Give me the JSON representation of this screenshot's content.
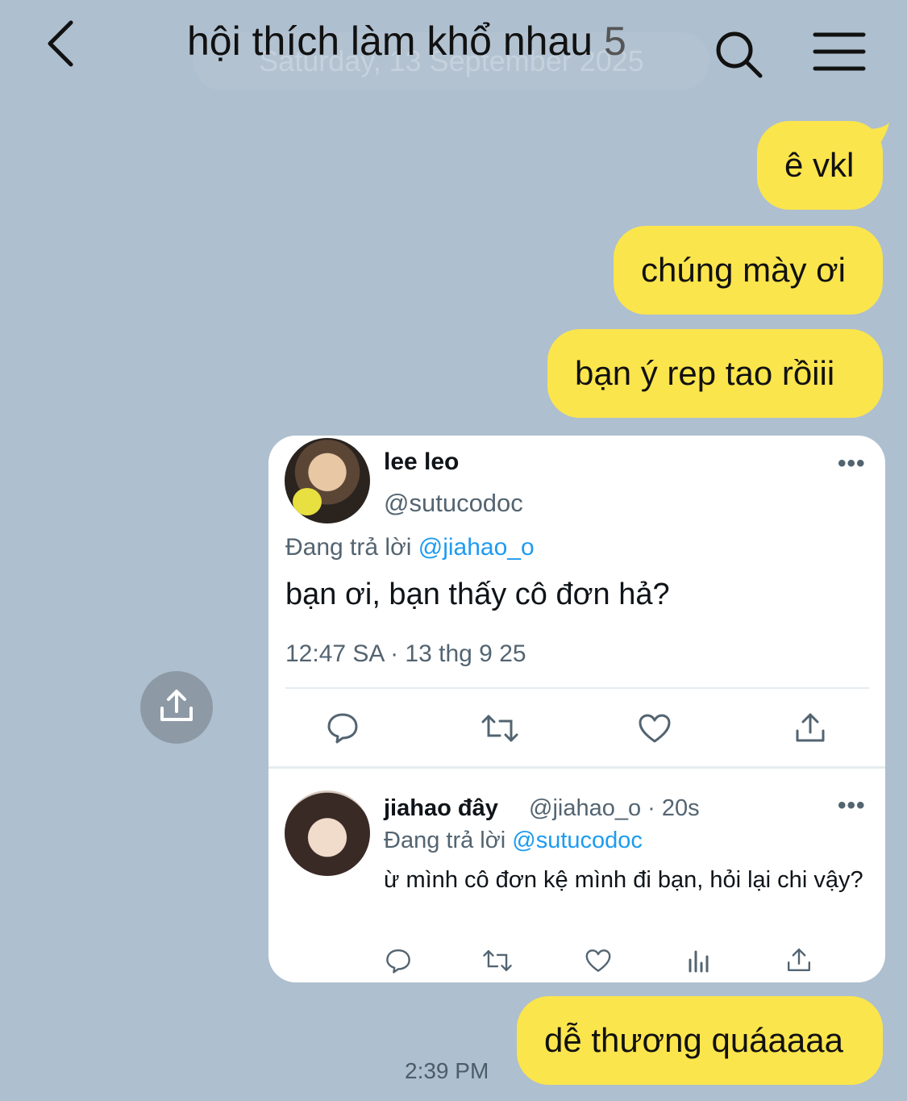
{
  "header": {
    "title": "hội thích làm khổ nhau",
    "member_count": "5",
    "date_banner": "Saturday, 13 September 2025",
    "back_icon": "chevron-left-icon",
    "search_icon": "search-icon",
    "menu_icon": "hamburger-menu-icon"
  },
  "messages": [
    {
      "text": "ê vkl"
    },
    {
      "text": "chúng mày ơi"
    },
    {
      "text": "bạn ý rep tao rồiii"
    },
    {
      "text": "dễ thương quáaaaa"
    }
  ],
  "timestamp": "2:39 PM",
  "share_fab_icon": "share-upload-icon",
  "screenshot_card": {
    "tweet": {
      "name": "lee leo",
      "handle": "@sutucodoc",
      "reply_prefix": "Đang trả lời ",
      "reply_to": "@jiahao_o",
      "text": "bạn ơi, bạn thấy cô đơn hả?",
      "meta": "12:47 SA · 13 thg 9 25",
      "more": "•••"
    },
    "reply": {
      "name": "jiahao đây",
      "handle_time": "@jiahao_o · 20s",
      "reply_prefix": "Đang trả lời ",
      "reply_to": "@sutucodoc",
      "text": "ừ mình cô đơn kệ mình đi bạn, hỏi lại chi vậy?",
      "more": "•••"
    }
  },
  "colors": {
    "background": "#aebfcf",
    "bubble": "#fbe54c",
    "link": "#1d9bf0",
    "muted": "#536471"
  }
}
